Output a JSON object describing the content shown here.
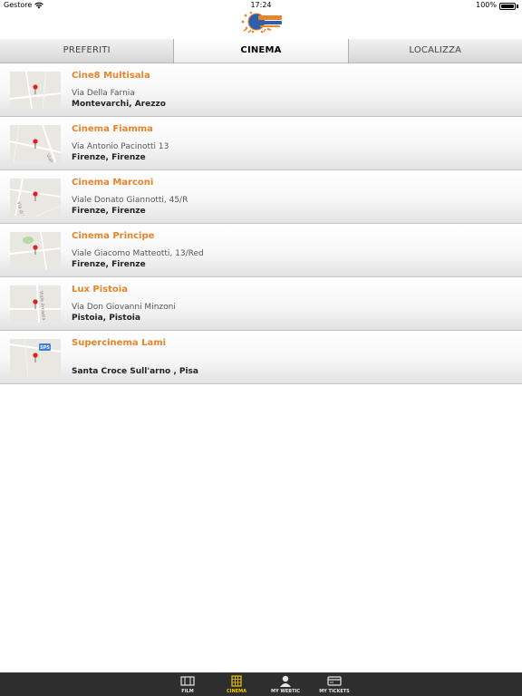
{
  "status_bar": {
    "carrier": "Gestore",
    "time": "17:24",
    "battery": "100%"
  },
  "header": {
    "logo_icon": "stasera-al-cinema-logo"
  },
  "tabs": [
    {
      "label": "PREFERITI",
      "active": false
    },
    {
      "label": "CINEMA",
      "active": true
    },
    {
      "label": "LOCALIZZA",
      "active": false
    }
  ],
  "cinemas": [
    {
      "name": "Cine8 Multisala",
      "address": "Via Della Farnia",
      "city": "Montevarchi, Arezzo",
      "map_label": ""
    },
    {
      "name": "Cinema Fiamma",
      "address": "Via Antonio Pacinotti 13",
      "city": "Firenze, Firenze",
      "map_label": "Viale G."
    },
    {
      "name": "Cinema Marconi",
      "address": "Viale Donato Giannotti, 45/R",
      "city": "Firenze, Firenze",
      "map_label": "Via di Ripoli"
    },
    {
      "name": "Cinema Principe",
      "address": "Viale Giacomo Matteotti, 13/Red",
      "city": "Firenze, Firenze",
      "map_label": ""
    },
    {
      "name": "Lux Pistoia",
      "address": "Via Don Giovanni Minzoni",
      "city": "Pistoia, Pistoia",
      "map_label": "Viale Arcadia"
    },
    {
      "name": "Supercinema Lami",
      "address": "",
      "city": "Santa Croce Sull'arno , Pisa",
      "map_label": "SP5"
    }
  ],
  "tabbar": [
    {
      "label": "FILM",
      "icon": "film-icon",
      "active": false
    },
    {
      "label": "CINEMA",
      "icon": "cinema-building-icon",
      "active": true
    },
    {
      "label": "MY WEBTIC",
      "icon": "user-icon",
      "active": false
    },
    {
      "label": "MY TICKETS",
      "icon": "ticket-icon",
      "active": false
    }
  ],
  "colors": {
    "accent": "#e8842a",
    "tabbar_bg": "#2e2e2e",
    "tabbar_active": "#f3c500"
  }
}
